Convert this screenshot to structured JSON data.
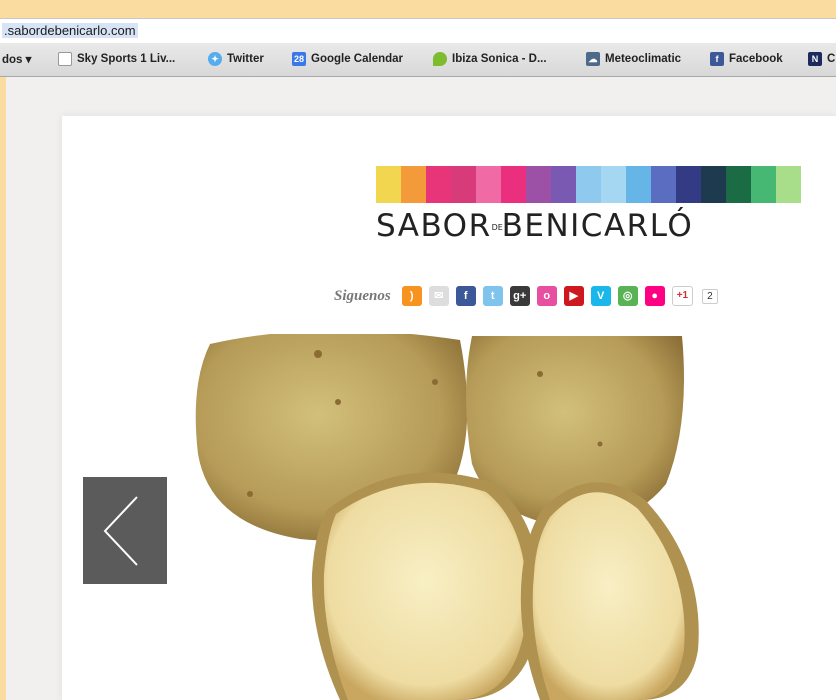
{
  "browser": {
    "url": ".sabordebenicarlo.com",
    "bookmarks": [
      {
        "label": "dos ▾",
        "icon": "folder-icon",
        "color": ""
      },
      {
        "label": "Sky Sports 1 Liv...",
        "icon": "page-icon",
        "color": "#ffffff"
      },
      {
        "label": "Twitter",
        "icon": "twitter-bird-icon",
        "color": "#55acee"
      },
      {
        "label": "Google Calendar",
        "icon": "calendar-icon",
        "color": "#3b78e7"
      },
      {
        "label": "Ibiza Sonica - D...",
        "icon": "leaf-icon",
        "color": "#7dbb2f"
      },
      {
        "label": "Meteoclimatic",
        "icon": "weather-icon",
        "color": "#4d6a8a"
      },
      {
        "label": "Facebook",
        "icon": "facebook-icon",
        "color": "#3b5998"
      },
      {
        "label": "C",
        "icon": "n-icon",
        "color": "#1d2a5c"
      }
    ]
  },
  "site": {
    "brand_left": "SABOR",
    "brand_connector": "DE",
    "brand_right": "BENICARLÓ",
    "stripe_colors": [
      "#f2d650",
      "#f39b3a",
      "#e8357a",
      "#d73b7a",
      "#f06aa6",
      "#ea2f7e",
      "#9c51a6",
      "#7a59b3",
      "#8fc9ee",
      "#a5d6f2",
      "#65b5e6",
      "#5a6dc0",
      "#333b85",
      "#1e3a4f",
      "#1b6c45",
      "#46b873",
      "#a8de8a"
    ],
    "follow_label": "Siguenos",
    "social_icons": [
      {
        "icon": "rss-icon",
        "color": "#f7931e",
        "glyph": ")"
      },
      {
        "icon": "mail-icon",
        "color": "#dddddd",
        "glyph": "✉"
      },
      {
        "icon": "facebook-icon",
        "color": "#3b5998",
        "glyph": "f"
      },
      {
        "icon": "twitter-icon",
        "color": "#7fc4ed",
        "glyph": "t"
      },
      {
        "icon": "google-plus-icon",
        "color": "#3a3a3a",
        "glyph": "g+"
      },
      {
        "icon": "orkut-icon",
        "color": "#e74fa0",
        "glyph": "o"
      },
      {
        "icon": "youtube-icon",
        "color": "#cc181e",
        "glyph": "▶"
      },
      {
        "icon": "vimeo-icon",
        "color": "#1ab7ea",
        "glyph": "V"
      },
      {
        "icon": "picasa-icon",
        "color": "#59b354",
        "glyph": "◎"
      },
      {
        "icon": "flickr-icon",
        "color": "#ff0084",
        "glyph": "●"
      }
    ],
    "gplus_button": "+1",
    "gplus_count": "2"
  }
}
